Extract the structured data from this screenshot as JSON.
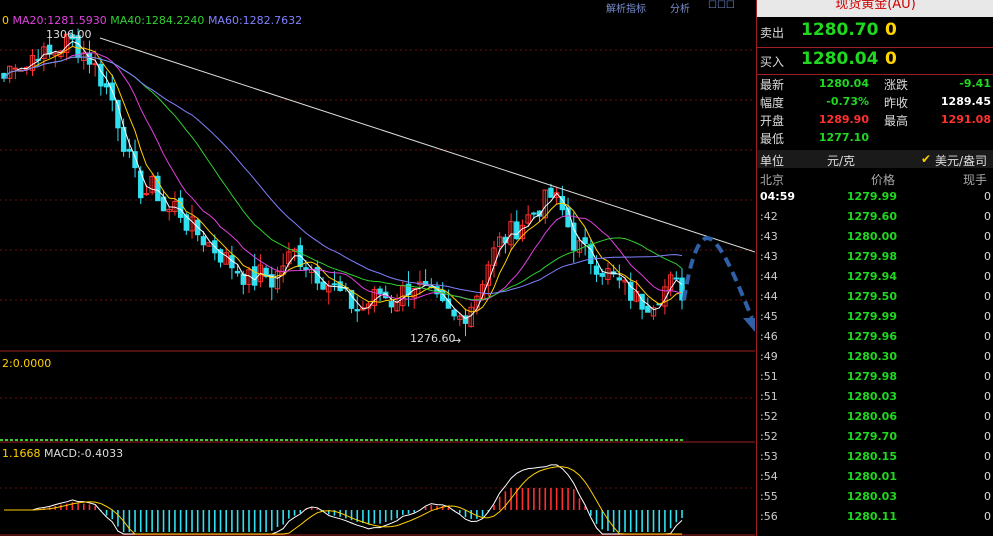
{
  "indicators": {
    "ma_line": [
      {
        "text": "0",
        "color": "#ffd000"
      },
      {
        "text": "MA20:1281.5930",
        "color": "#e040e0"
      },
      {
        "text": "MA40:1284.2240",
        "color": "#30d030"
      },
      {
        "text": "MA60:1282.7632",
        "color": "#8080ff"
      }
    ],
    "vol_line": "2:0.0000",
    "macd_line": [
      {
        "text": "1.1668",
        "color": "#ffd000"
      },
      {
        "text": "MACD:-0.4033",
        "color": "#dddddd"
      }
    ]
  },
  "annotations": {
    "high_label": "1306.00",
    "low_label": "1276.60"
  },
  "top_links": [
    "解析指标",
    "分析",
    "☐☐☐"
  ],
  "panel": {
    "title": "现货黄金(AU)",
    "sell_label": "卖出",
    "sell_price": "1280.70",
    "sell_vol": "0",
    "buy_label": "买入",
    "buy_price": "1280.04",
    "buy_vol": "0",
    "stats": {
      "latest_label": "最新",
      "latest": "1280.04",
      "change_label": "涨跌",
      "change": "-9.41",
      "pct_label": "幅度",
      "pct": "-0.73%",
      "prev_label": "昨收",
      "prev": "1289.45",
      "open_label": "开盘",
      "open": "1289.90",
      "high_label": "最高",
      "high": "1291.08",
      "low_label": "最低",
      "low": "1277.10"
    },
    "unit_label": "单位",
    "unit_value": "元/克",
    "unit_option": "美元/盎司",
    "col_location": "北京",
    "col_price": "价格",
    "col_vol": "现手",
    "ticks": [
      {
        "time": "04:59",
        "price": "1279.99",
        "vol": "0"
      },
      {
        "time": ":42",
        "price": "1279.60",
        "vol": "0"
      },
      {
        "time": ":43",
        "price": "1280.00",
        "vol": "0"
      },
      {
        "time": ":43",
        "price": "1279.98",
        "vol": "0"
      },
      {
        "time": ":44",
        "price": "1279.94",
        "vol": "0"
      },
      {
        "time": ":44",
        "price": "1279.50",
        "vol": "0"
      },
      {
        "time": ":45",
        "price": "1279.99",
        "vol": "0"
      },
      {
        "time": ":46",
        "price": "1279.96",
        "vol": "0"
      },
      {
        "time": ":49",
        "price": "1280.30",
        "vol": "0"
      },
      {
        "time": ":51",
        "price": "1279.98",
        "vol": "0"
      },
      {
        "time": ":51",
        "price": "1280.03",
        "vol": "0"
      },
      {
        "time": ":52",
        "price": "1280.06",
        "vol": "0"
      },
      {
        "time": ":52",
        "price": "1279.70",
        "vol": "0"
      },
      {
        "time": ":53",
        "price": "1280.15",
        "vol": "0"
      },
      {
        "time": ":54",
        "price": "1280.01",
        "vol": "0"
      },
      {
        "time": ":55",
        "price": "1280.03",
        "vol": "0"
      },
      {
        "time": ":56",
        "price": "1280.11",
        "vol": "0"
      }
    ]
  },
  "colors": {
    "bull": "#ff3030",
    "bear": "#30e0f0",
    "ma5": "#ffffff",
    "ma10": "#ffd000",
    "ma20": "#e040e0",
    "ma40": "#30d030",
    "ma60": "#8080ff",
    "trendline": "#dddddd",
    "forecast_arrow": "#3060a8",
    "grid": "#6a1010"
  },
  "chart_data": {
    "type": "candlestick",
    "y_range_price": [
      1274,
      1309
    ],
    "close_path": [
      1302,
      1304,
      1303,
      1305,
      1304,
      1305,
      1306,
      1305,
      1304,
      1302,
      1300,
      1296,
      1292,
      1290,
      1291,
      1288,
      1289,
      1287,
      1286,
      1285,
      1284,
      1283,
      1282,
      1281,
      1282,
      1281,
      1283,
      1284,
      1283,
      1282,
      1281,
      1280,
      1279,
      1278,
      1279,
      1280,
      1279,
      1280,
      1281,
      1280,
      1279,
      1278,
      1277,
      1278,
      1280,
      1283,
      1285,
      1286,
      1287,
      1288,
      1289,
      1290,
      1288,
      1285,
      1284,
      1283,
      1282,
      1281,
      1280,
      1279,
      1279,
      1280,
      1281,
      1280
    ]
  }
}
